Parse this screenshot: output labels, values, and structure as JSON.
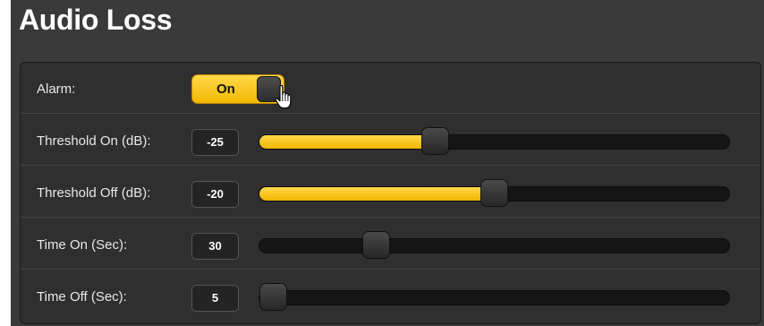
{
  "title": "Audio Loss",
  "alarm": {
    "label": "Alarm:",
    "toggle_text": "On",
    "state": "on"
  },
  "rows": [
    {
      "label": "Threshold On (dB):",
      "value": "-25",
      "level": 0.375
    },
    {
      "label": "Threshold Off (dB):",
      "value": "-20",
      "level": 0.5
    },
    {
      "label": "Time On (Sec):",
      "value": "30",
      "level": 0.25
    },
    {
      "label": "Time Off (Sec):",
      "value": "5",
      "level": 0.03
    }
  ],
  "colors": {
    "accent": "#f6c01c",
    "background": "#3a3a3a",
    "panel": "#2f2f2f",
    "track": "#151515"
  },
  "icons": {
    "cursor": "hand-pointer-icon"
  }
}
